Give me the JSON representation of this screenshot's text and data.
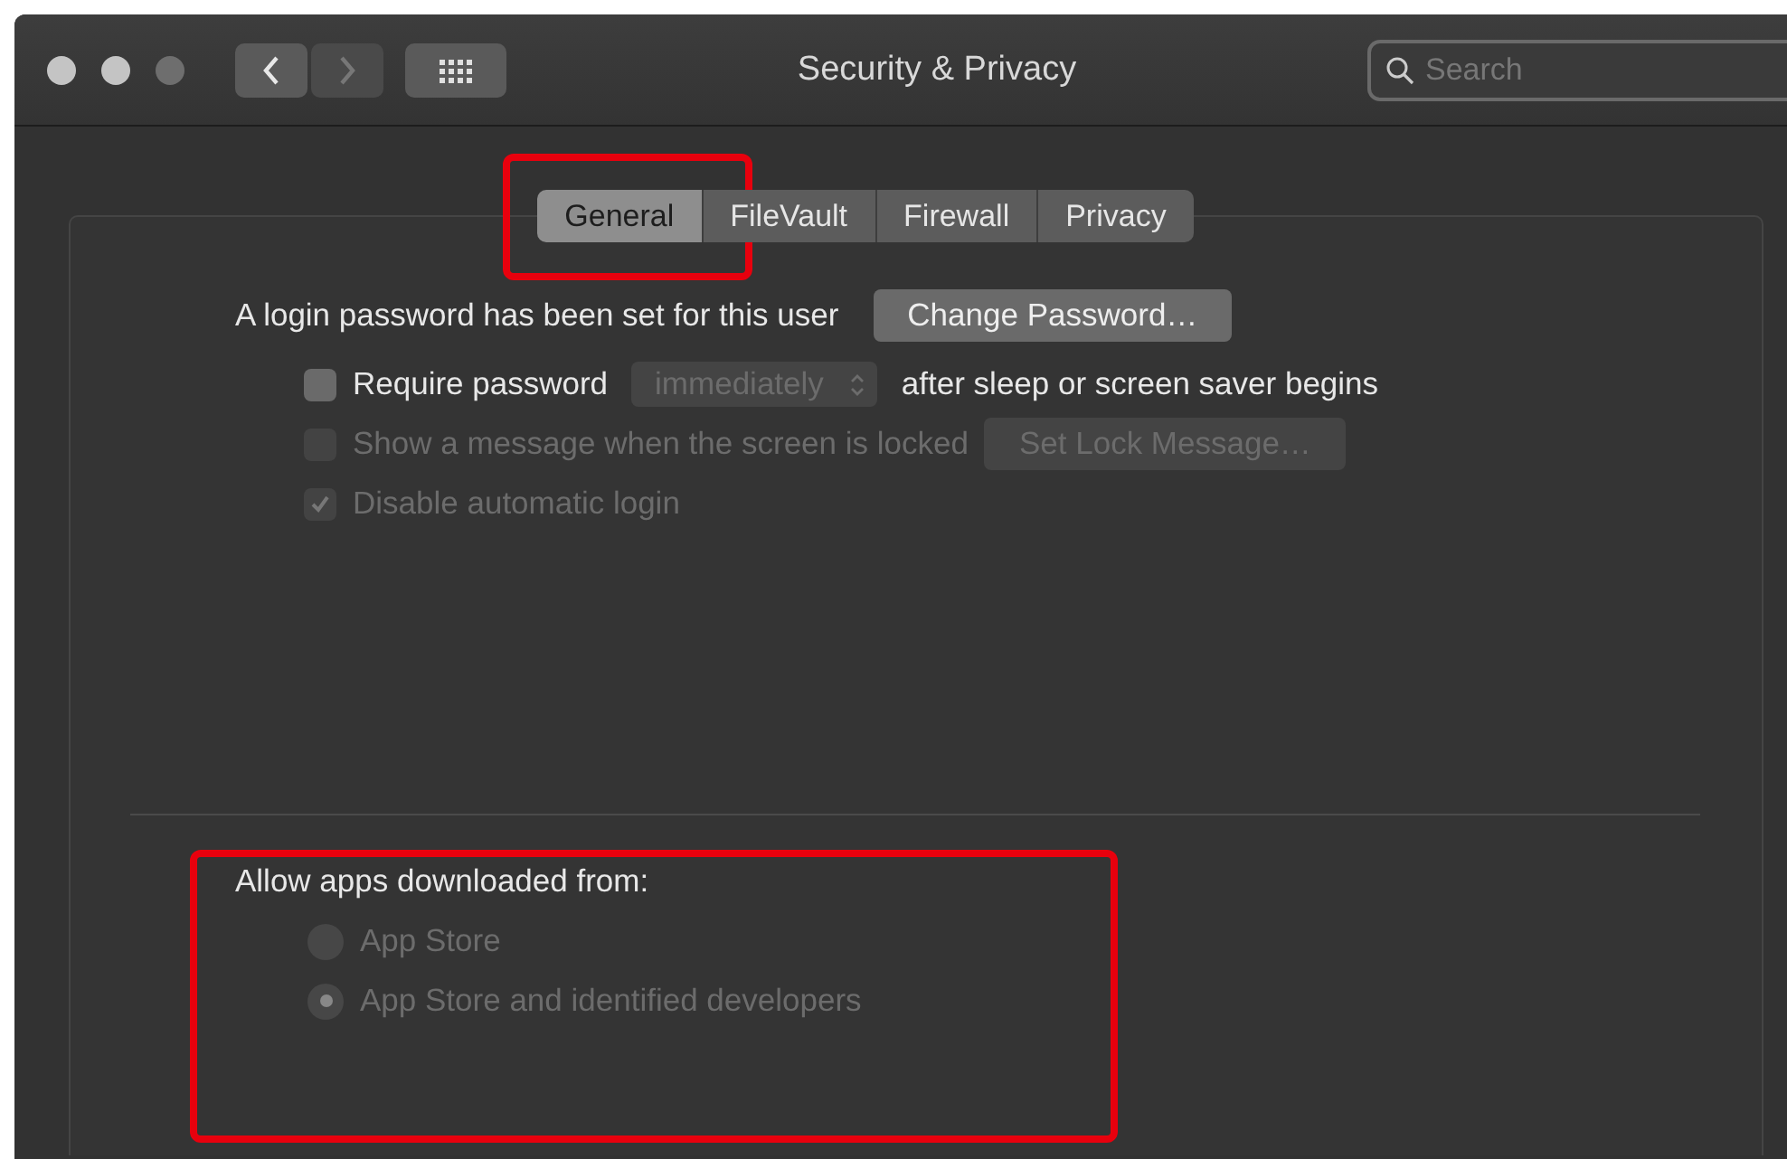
{
  "window": {
    "title": "Security & Privacy"
  },
  "toolbar": {
    "search": {
      "placeholder": "Search"
    }
  },
  "tabs": [
    {
      "label": "General",
      "selected": true
    },
    {
      "label": "FileVault",
      "selected": false
    },
    {
      "label": "Firewall",
      "selected": false
    },
    {
      "label": "Privacy",
      "selected": false
    }
  ],
  "login": {
    "text": "A login password has been set for this user",
    "button": "Change Password…"
  },
  "options": [
    {
      "kind": "checkbox-popup",
      "label": "Require password",
      "checked": false,
      "disabled": false,
      "popup": "immediately",
      "popup_disabled": true,
      "suffix": "after sleep or screen saver begins"
    },
    {
      "kind": "checkbox-button",
      "label": "Show a message when the screen is locked",
      "checked": false,
      "disabled": true,
      "button": "Set Lock Message…"
    },
    {
      "kind": "checkbox",
      "label": "Disable automatic login",
      "checked": true,
      "disabled": true
    }
  ],
  "allow_apps": {
    "heading": "Allow apps downloaded from:",
    "choices": [
      {
        "label": "App Store",
        "selected": false,
        "disabled": true
      },
      {
        "label": "App Store and identified developers",
        "selected": true,
        "disabled": true
      }
    ]
  }
}
